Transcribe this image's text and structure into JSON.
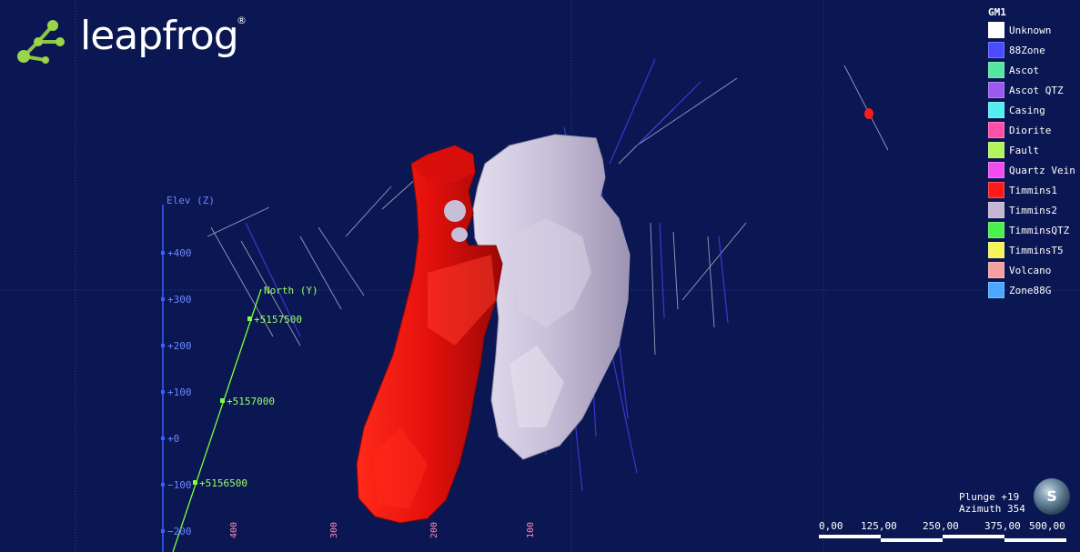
{
  "app": {
    "logo_name": "leapfrog",
    "logo_registered": "®"
  },
  "legend": {
    "title": "GM1",
    "items": [
      {
        "label": "Unknown",
        "color": "#ffffff"
      },
      {
        "label": "88Zone",
        "color": "#4a4aff"
      },
      {
        "label": "Ascot",
        "color": "#55e6a3"
      },
      {
        "label": "Ascot QTZ",
        "color": "#9b59f0"
      },
      {
        "label": "Casing",
        "color": "#55eef0"
      },
      {
        "label": "Diorite",
        "color": "#ff4fa8"
      },
      {
        "label": "Fault",
        "color": "#b2f55a"
      },
      {
        "label": "Quartz Vein",
        "color": "#f04cf0"
      },
      {
        "label": "Timmins1",
        "color": "#ff1a1a"
      },
      {
        "label": "Timmins2",
        "color": "#c4b6d2"
      },
      {
        "label": "TimminsQTZ",
        "color": "#4cf04c"
      },
      {
        "label": "TimminsT5",
        "color": "#f5f55a"
      },
      {
        "label": "Volcano",
        "color": "#f5a0a0"
      },
      {
        "label": "Zone88G",
        "color": "#4aa8ff"
      }
    ]
  },
  "axes": {
    "elev_label": "Elev (Z)",
    "elev_ticks": [
      "+400",
      "+300",
      "+200",
      "+100",
      "+0",
      "−100",
      "−200"
    ],
    "north_label": "North (Y)",
    "north_ticks": [
      "+5157500",
      "+5157000",
      "+5156500"
    ],
    "bottom_ticks": [
      "400",
      "300",
      "200",
      "100"
    ]
  },
  "orientation": {
    "plunge": "Plunge +19",
    "azimuth": "Azimuth 354",
    "compass_letter": "S"
  },
  "scale": {
    "labels": [
      "0,00",
      "125,00",
      "250,00",
      "375,00",
      "500,00"
    ]
  },
  "colors": {
    "background": "#0b1752",
    "elev_axis": "#3d5cff",
    "north_axis": "#7cff40",
    "bottom_axis": "#ff8ab0",
    "body_red": "#e8120f",
    "body_lilac": "#c7bfd8"
  }
}
